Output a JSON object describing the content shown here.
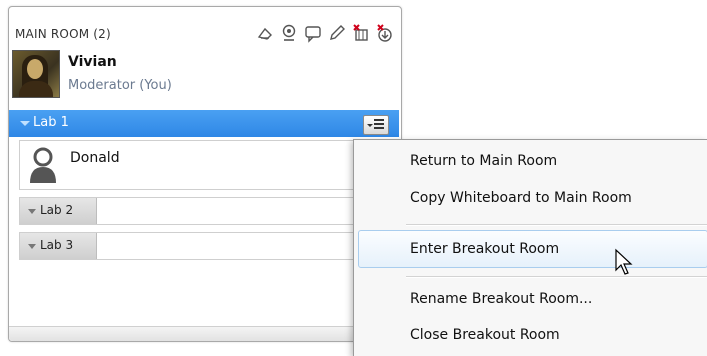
{
  "panel": {
    "title": "MAIN ROOM (2)",
    "toolbar_icons": [
      "pointer-hand-icon",
      "webcam-icon",
      "chat-bubble-icon",
      "pencil-icon",
      "delete-room-icon",
      "delete-download-icon"
    ]
  },
  "user": {
    "name": "Vivian",
    "role": "Moderator (You)",
    "avatar_icon": "mona-lisa-avatar"
  },
  "rooms": [
    {
      "label": "Lab 1",
      "expanded": true,
      "selected": true,
      "members": [
        {
          "name": "Donald",
          "icon": "user-silhouette-icon"
        }
      ]
    },
    {
      "label": "Lab 2",
      "expanded": false
    },
    {
      "label": "Lab 3",
      "expanded": false
    }
  ],
  "context_menu": {
    "items": [
      {
        "label": "Return to Main Room"
      },
      {
        "label": "Copy Whiteboard to Main Room"
      },
      {
        "label": "Enter Breakout Room",
        "hovered": true
      },
      {
        "label": "Rename Breakout Room..."
      },
      {
        "label": "Close Breakout Room"
      }
    ]
  },
  "colors": {
    "selected_row": "#2e87e6",
    "menu_hover": "#e6f1fb",
    "role_text": "#6b7a90"
  }
}
